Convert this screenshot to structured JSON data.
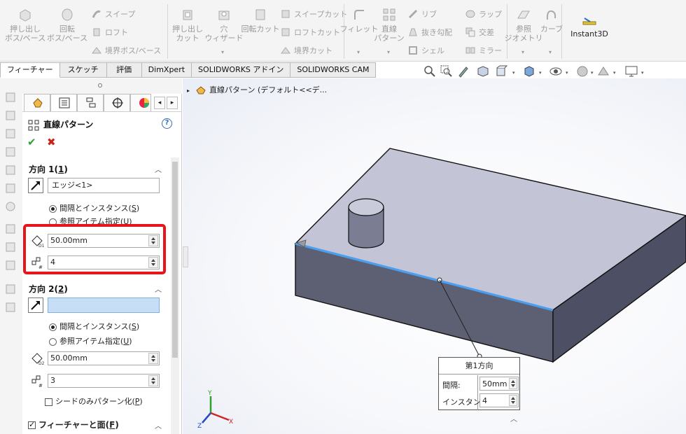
{
  "ribbon": {
    "boss_extrude": "押し出し\nボス/ベース",
    "revolve_boss": "回転\nボス/ベース",
    "sweep": "スイープ",
    "loft": "ロフト",
    "boundary_boss": "境界ボス/ベース",
    "extrude_cut": "押し出し\nカット",
    "hole_wizard": "穴\nウィザード",
    "revolve_cut": "回転カット",
    "sweep_cut": "スイープカット",
    "loft_cut": "ロフトカット",
    "boundary_cut": "境界カット",
    "fillet": "フィレット",
    "linear_pattern": "直線\nパターン",
    "rib": "リブ",
    "draft": "抜き勾配",
    "shell": "シェル",
    "wrap": "ラップ",
    "intersect": "交差",
    "mirror": "ミラー",
    "ref_geometry": "参照\nジオメトリ",
    "curves": "カーブ",
    "instant3d": "Instant3D"
  },
  "tabs": [
    "フィーチャー",
    "スケッチ",
    "評価",
    "DimXpert",
    "SOLIDWORKS アドイン",
    "SOLIDWORKS CAM"
  ],
  "pm": {
    "title": "直線パターン",
    "help": "?",
    "ok": "✔",
    "cancel": "✖",
    "dir1": {
      "header": "方向 1(",
      "key": "1",
      "header_end": ")",
      "edge": "エッジ<1>",
      "radio_spacing": "間隔とインスタンス(",
      "radio_spacing_key": "S",
      "radio_ref": "参照アイテム指定(",
      "radio_ref_key": "U",
      "radio_end": ")",
      "spacing": "50.00mm",
      "instances": "4"
    },
    "dir2": {
      "header": "方向 2(",
      "key": "2",
      "header_end": ")",
      "edge": "",
      "radio_spacing": "間隔とインスタンス(",
      "radio_spacing_key": "S",
      "radio_ref": "参照アイテム指定(",
      "radio_ref_key": "U",
      "radio_end": ")",
      "spacing": "50.00mm",
      "instances": "3",
      "seed_only": "シードのみパターン化(",
      "seed_only_key": "P",
      "seed_end": ")"
    },
    "features_faces": "フィーチャーと面(",
    "features_faces_key": "F",
    "features_faces_end": ")"
  },
  "viewport": {
    "tree_item": "直線パターン (デフォルト<<デ..."
  },
  "callout": {
    "title": "第1方向",
    "spacing_label": "間隔:",
    "spacing_value": "50mm",
    "instances_label": "インスタンス:",
    "instances_value": "4"
  },
  "triad": {
    "x": "X",
    "y": "Y",
    "z": "Z"
  },
  "colors": {
    "highlight_frame": "#e8141c",
    "selected_edge": "#4a9ff0",
    "ok_green": "#2ea030",
    "cancel_red": "#c8221a"
  }
}
